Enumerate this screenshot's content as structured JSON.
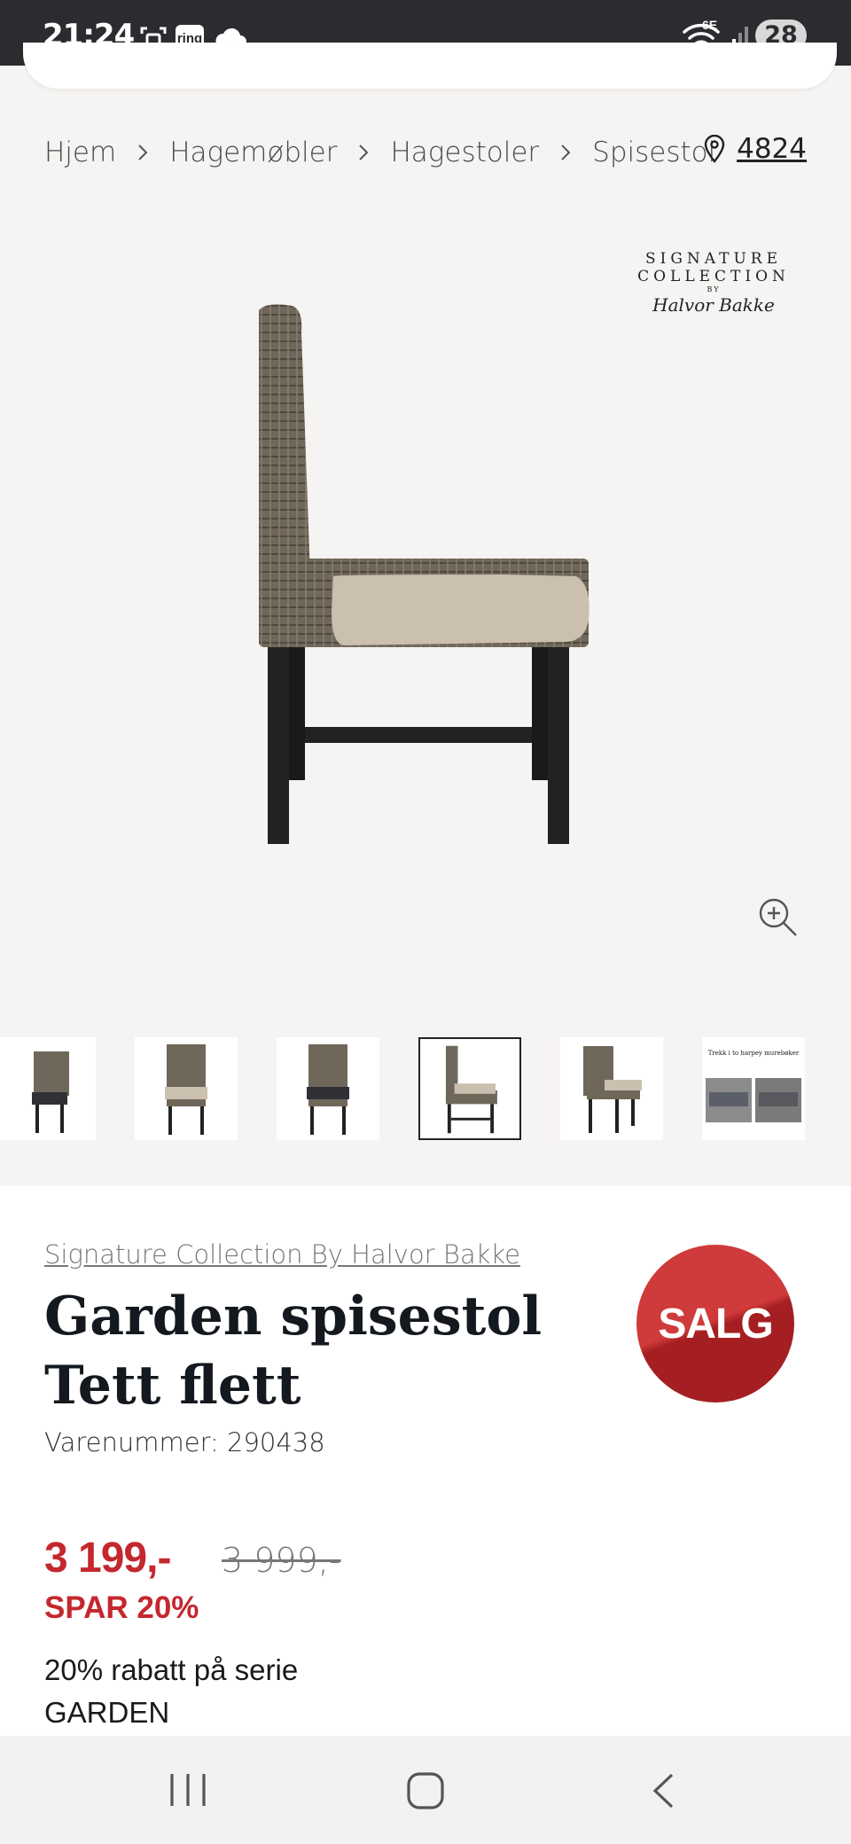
{
  "status_bar": {
    "time": "21:24",
    "ring_label": "ring",
    "network": "6E",
    "battery": "28",
    "icons": [
      "screenshot-icon",
      "ring-app-icon",
      "cloud-icon",
      "wifi-icon",
      "signal-icon"
    ]
  },
  "breadcrumb": {
    "items": [
      "Hjem",
      "Hagemøbler",
      "Hagestoler",
      "Spisestol"
    ]
  },
  "store": {
    "code": "4824",
    "icon": "location-pin-icon"
  },
  "brand_logo": {
    "line1": "SIGNATURE",
    "line2": "COLLECTION",
    "by": "BY",
    "signature": "Halvor Bakke"
  },
  "gallery": {
    "thumbnails": 6,
    "active_index": 3,
    "banner_title": "Trekk i to harpey murebøker"
  },
  "product": {
    "brand": "Signature Collection By Halvor Bakke",
    "title": "Garden spisestol Tett flett",
    "sku": "Varenummer: 290438",
    "badge": "SALG",
    "price": "3 199,-",
    "old_price": "3 999,-",
    "savings": "SPAR 20%",
    "promo": "20% rabatt på serie GARDEN"
  },
  "colors": {
    "sale_red": "#c4282e",
    "status_bar": "#2b2c30",
    "page_bg": "#f6f4f2"
  },
  "navbar": {
    "icons": [
      "recent-apps-icon",
      "home-icon",
      "back-icon"
    ]
  }
}
